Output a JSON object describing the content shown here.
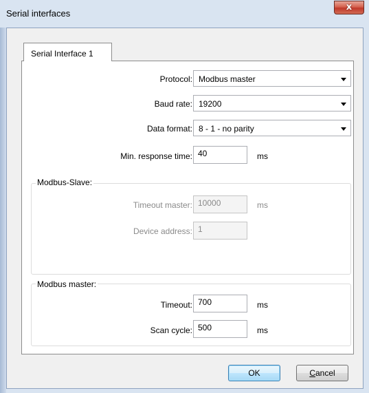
{
  "window": {
    "title": "Serial interfaces",
    "close_symbol": "x"
  },
  "tabs": [
    {
      "label": "Serial Interface 1",
      "active": true
    }
  ],
  "settings": {
    "protocol": {
      "label": "Protocol:",
      "value": "Modbus master"
    },
    "baud_rate": {
      "label": "Baud rate:",
      "value": "19200"
    },
    "data_format": {
      "label": "Data format:",
      "value": "8 - 1 - no parity"
    },
    "min_response_time": {
      "label": "Min. response time:",
      "value": "40",
      "unit": "ms"
    }
  },
  "modbus_slave": {
    "title": "Modbus-Slave:",
    "timeout_master": {
      "label": "Timeout master:",
      "value": "10000",
      "unit": "ms",
      "enabled": false
    },
    "device_address": {
      "label": "Device address:",
      "value": "1",
      "enabled": false
    }
  },
  "modbus_master": {
    "title": "Modbus master:",
    "timeout": {
      "label": "Timeout:",
      "value": "700",
      "unit": "ms"
    },
    "scan_cycle": {
      "label": "Scan cycle:",
      "value": "500",
      "unit": "ms"
    }
  },
  "buttons": {
    "ok": "OK",
    "cancel": "Cancel"
  },
  "colors": {
    "close_button": "#c0392b",
    "title_bar": "#d9e4f1",
    "dialog_bg": "#f0f0f0",
    "default_button_border": "#3c7fb1"
  }
}
